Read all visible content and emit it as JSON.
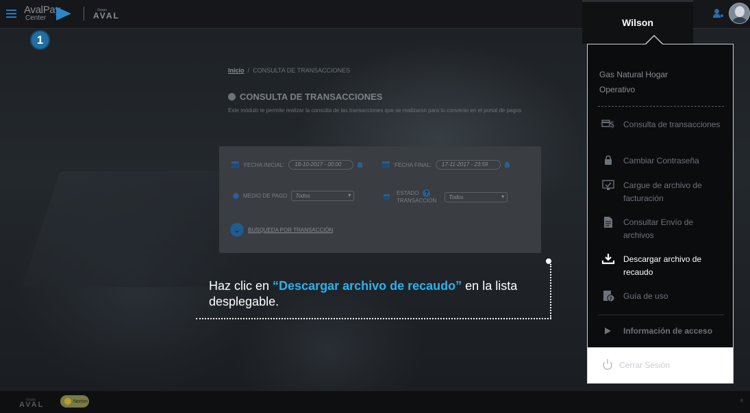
{
  "header": {
    "logo_line1": "AvalPay",
    "logo_line2": "Center",
    "group_small": "Grupo",
    "group_brand": "AVAL"
  },
  "step_badge": "1",
  "breadcrumb": {
    "home": "Inicio",
    "separator": "/",
    "current": "CONSULTA DE TRANSACCIONES"
  },
  "page": {
    "title": "CONSULTA DE TRANSACCIONES",
    "description": "Este módulo te permite realizar la consulta de las transacciones que se realizaron para tu convenio en el portal de pagos"
  },
  "form": {
    "fecha_inicial_label": "FECHA INICIAL:",
    "fecha_inicial_value": "18-10-2017 - 00:00",
    "fecha_final_label": "FECHA FINAL:",
    "fecha_final_value": "17-11-2017 - 23:59",
    "required_mark": "*",
    "medio_pago_label": "MEDIO DE PAGO",
    "medio_pago_value": "Todos",
    "estado_label_1": "ESTADO",
    "estado_label_2": "TRANSACCIÓN",
    "estado_value": "Todos",
    "help_mark": "?",
    "search_link": "BUSQUEDA POR TRANSACCIÓN"
  },
  "callout": {
    "prefix": "Haz clic en ",
    "highlight": "“Descargar archivo de recaudo”",
    "suffix": " en la lista desplegable."
  },
  "user": {
    "name": "Wilson"
  },
  "dropdown": {
    "company_line1": "Gas Natural Hogar",
    "company_line2": "Operativo",
    "items": [
      {
        "label": "Consulta de transacciones",
        "icon": "card-dollar-icon"
      },
      {
        "label": "Cambiar Contraseña",
        "icon": "lock-icon"
      },
      {
        "label": "Cargue de archivo de facturación",
        "icon": "monitor-check-icon"
      },
      {
        "label": "Consultar Envío de archivos",
        "icon": "document-icon"
      },
      {
        "label": "Descargar archivo de recaudo",
        "icon": "download-icon"
      },
      {
        "label": "Guía de uso",
        "icon": "guide-help-icon"
      }
    ],
    "access_label": "Información de acceso",
    "logout_label": "Cerrar Sesión"
  },
  "footer": {
    "brand": "AVAL",
    "brand_small": "Grupo",
    "norton": "Norton",
    "mark": "®"
  },
  "colors": {
    "accent": "#2ab2ec",
    "brand_blue": "#1f6fa3"
  }
}
